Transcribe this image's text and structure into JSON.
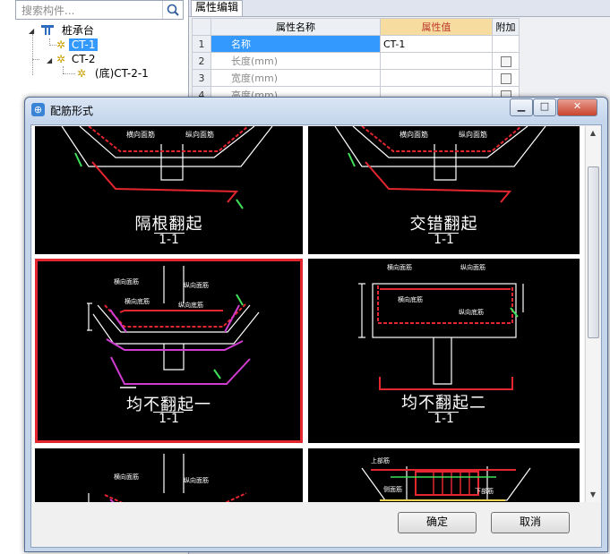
{
  "search": {
    "placeholder": "搜索构件..."
  },
  "tree": {
    "root": "桩承台",
    "items": [
      {
        "label": "CT-1"
      },
      {
        "label": "CT-2"
      },
      {
        "label": "(底)CT-2-1"
      }
    ]
  },
  "properties": {
    "tab": "属性编辑",
    "headers": {
      "name": "属性名称",
      "value": "属性值",
      "extra": "附加"
    },
    "rows": [
      {
        "num": "1",
        "name": "名称",
        "value": "CT-1"
      },
      {
        "num": "2",
        "name": "长度(mm)",
        "value": ""
      },
      {
        "num": "3",
        "name": "宽度(mm)",
        "value": ""
      },
      {
        "num": "4",
        "name": "高度(mm)",
        "value": ""
      }
    ]
  },
  "dialog": {
    "title": "配筋形式",
    "options": [
      {
        "title": "隔根翻起",
        "section": "1-1"
      },
      {
        "title": "交错翻起",
        "section": "1-1"
      },
      {
        "title": "均不翻起一",
        "section": "1-1"
      },
      {
        "title": "均不翻起二",
        "section": "1-1"
      }
    ],
    "labels": {
      "long_top": "横向面筋",
      "long_bottom": "横向底筋",
      "trans_top": "纵向面筋",
      "trans_bottom": "纵向底筋",
      "top_cover": "上部筋",
      "stirrup": "侧面筋",
      "lower": "下部筋"
    },
    "ok": "确定",
    "cancel": "取消"
  },
  "colors": {
    "accent": "#3399ff",
    "rebar": "#e3262f",
    "bent": "#d03cd0",
    "dim": "#3fe05a",
    "select": "#e3262f"
  }
}
